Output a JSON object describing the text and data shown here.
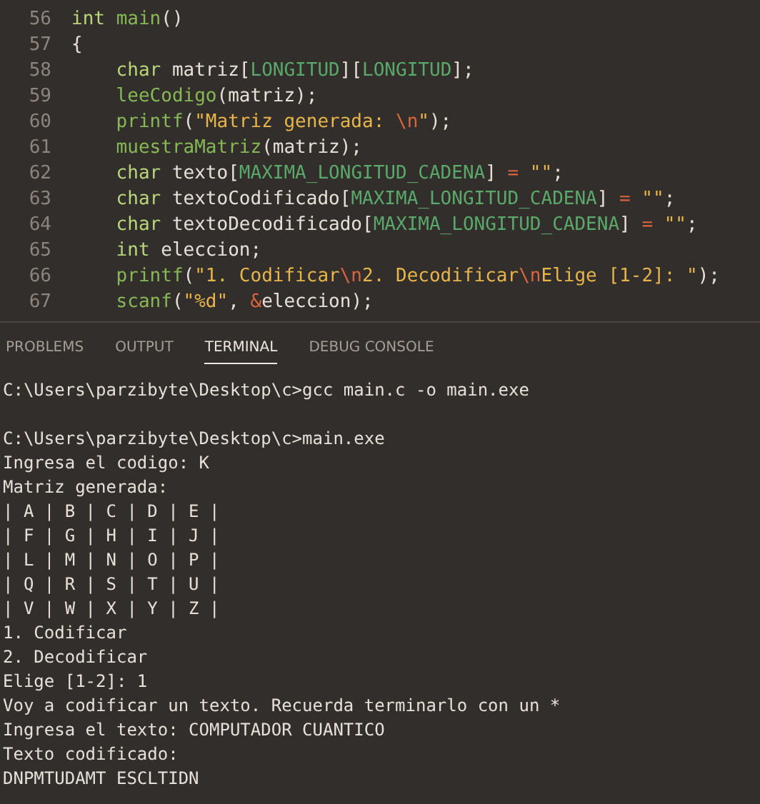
{
  "editor": {
    "lines": [
      {
        "number": "56",
        "tokens": [
          {
            "text": "int ",
            "kind": "keyword"
          },
          {
            "text": "main",
            "kind": "function"
          },
          {
            "text": "()",
            "kind": "plain"
          }
        ]
      },
      {
        "number": "57",
        "tokens": [
          {
            "text": "{",
            "kind": "plain"
          }
        ]
      },
      {
        "number": "58",
        "tokens": [
          {
            "text": "    char",
            "kind": "keyword"
          },
          {
            "text": " matriz[",
            "kind": "plain"
          },
          {
            "text": "LONGITUD",
            "kind": "constant"
          },
          {
            "text": "][",
            "kind": "plain"
          },
          {
            "text": "LONGITUD",
            "kind": "constant"
          },
          {
            "text": "];",
            "kind": "plain"
          }
        ]
      },
      {
        "number": "59",
        "tokens": [
          {
            "text": "    leeCodigo",
            "kind": "function"
          },
          {
            "text": "(matriz);",
            "kind": "plain"
          }
        ]
      },
      {
        "number": "60",
        "tokens": [
          {
            "text": "    printf",
            "kind": "function"
          },
          {
            "text": "(",
            "kind": "plain"
          },
          {
            "text": "\"Matriz generada: ",
            "kind": "string"
          },
          {
            "text": "\\n",
            "kind": "escape"
          },
          {
            "text": "\"",
            "kind": "string"
          },
          {
            "text": ");",
            "kind": "plain"
          }
        ]
      },
      {
        "number": "61",
        "tokens": [
          {
            "text": "    muestraMatriz",
            "kind": "function"
          },
          {
            "text": "(matriz);",
            "kind": "plain"
          }
        ]
      },
      {
        "number": "62",
        "tokens": [
          {
            "text": "    char",
            "kind": "keyword"
          },
          {
            "text": " texto[",
            "kind": "plain"
          },
          {
            "text": "MAXIMA_LONGITUD_CADENA",
            "kind": "constant"
          },
          {
            "text": "] ",
            "kind": "plain"
          },
          {
            "text": "=",
            "kind": "operator"
          },
          {
            "text": " \"\"",
            "kind": "string"
          },
          {
            "text": ";",
            "kind": "plain"
          }
        ]
      },
      {
        "number": "63",
        "tokens": [
          {
            "text": "    char",
            "kind": "keyword"
          },
          {
            "text": " textoCodificado[",
            "kind": "plain"
          },
          {
            "text": "MAXIMA_LONGITUD_CADENA",
            "kind": "constant"
          },
          {
            "text": "] ",
            "kind": "plain"
          },
          {
            "text": "=",
            "kind": "operator"
          },
          {
            "text": " \"\"",
            "kind": "string"
          },
          {
            "text": ";",
            "kind": "plain"
          }
        ]
      },
      {
        "number": "64",
        "tokens": [
          {
            "text": "    char",
            "kind": "keyword"
          },
          {
            "text": " textoDecodificado[",
            "kind": "plain"
          },
          {
            "text": "MAXIMA_LONGITUD_CADENA",
            "kind": "constant"
          },
          {
            "text": "] ",
            "kind": "plain"
          },
          {
            "text": "=",
            "kind": "operator"
          },
          {
            "text": " \"\"",
            "kind": "string"
          },
          {
            "text": ";",
            "kind": "plain"
          }
        ]
      },
      {
        "number": "65",
        "tokens": [
          {
            "text": "    int",
            "kind": "keyword"
          },
          {
            "text": " eleccion;",
            "kind": "plain"
          }
        ]
      },
      {
        "number": "66",
        "tokens": [
          {
            "text": "    printf",
            "kind": "function"
          },
          {
            "text": "(",
            "kind": "plain"
          },
          {
            "text": "\"1. Codificar",
            "kind": "string"
          },
          {
            "text": "\\n",
            "kind": "escape"
          },
          {
            "text": "2. Decodificar",
            "kind": "string"
          },
          {
            "text": "\\n",
            "kind": "escape"
          },
          {
            "text": "Elige [1-2]: \"",
            "kind": "string"
          },
          {
            "text": ");",
            "kind": "plain"
          }
        ]
      },
      {
        "number": "67",
        "tokens": [
          {
            "text": "    scanf",
            "kind": "function"
          },
          {
            "text": "(",
            "kind": "plain"
          },
          {
            "text": "\"%d\"",
            "kind": "string"
          },
          {
            "text": ", ",
            "kind": "plain"
          },
          {
            "text": "&",
            "kind": "operator"
          },
          {
            "text": "eleccion);",
            "kind": "plain"
          }
        ]
      }
    ]
  },
  "panel_tabs": [
    {
      "label": "PROBLEMS",
      "selected": false
    },
    {
      "label": "OUTPUT",
      "selected": false
    },
    {
      "label": "TERMINAL",
      "selected": true
    },
    {
      "label": "DEBUG CONSOLE",
      "selected": false
    }
  ],
  "terminal": {
    "blocks": [
      [
        "C:\\Users\\parzibyte\\Desktop\\c>gcc main.c -o main.exe"
      ],
      [
        "C:\\Users\\parzibyte\\Desktop\\c>main.exe",
        "Ingresa el codigo: K",
        "Matriz generada:",
        "| A | B | C | D | E |",
        "| F | G | H | I | J |",
        "| L | M | N | O | P |",
        "| Q | R | S | T | U |",
        "| V | W | X | Y | Z |",
        "1. Codificar",
        "2. Decodificar",
        "Elige [1-2]: 1",
        "Voy a codificar un texto. Recuerda terminarlo con un *",
        "Ingresa el texto: COMPUTADOR CUANTICO",
        "Texto codificado:",
        "DNPMTUDAMT ESCLTIDN"
      ]
    ]
  }
}
